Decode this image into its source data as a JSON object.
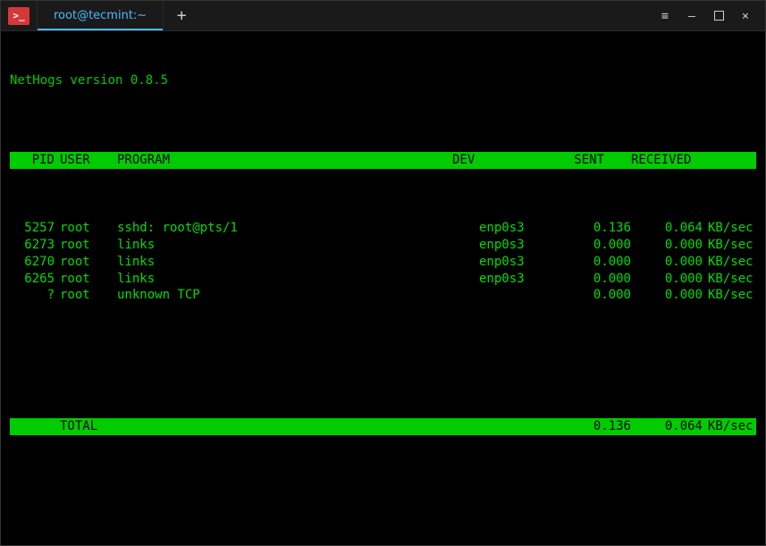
{
  "titlebar": {
    "app_icon_glyph": ">_",
    "tab_title": "root@tecmint:~",
    "new_tab_glyph": "+"
  },
  "window_controls": {
    "menu": "≡",
    "minimize": "–",
    "maximize": "▢",
    "close": "×"
  },
  "terminal": {
    "version_line": "NetHogs version 0.8.5",
    "headers": {
      "pid": "PID",
      "user": "USER",
      "program": "PROGRAM",
      "dev": "DEV",
      "sent": "SENT",
      "received": "RECEIVED"
    },
    "rows": [
      {
        "pid": "5257",
        "user": "root",
        "program": "sshd: root@pts/1",
        "dev": "enp0s3",
        "sent": "0.136",
        "recv": "0.064",
        "unit": "KB/sec"
      },
      {
        "pid": "6273",
        "user": "root",
        "program": "links",
        "dev": "enp0s3",
        "sent": "0.000",
        "recv": "0.000",
        "unit": "KB/sec"
      },
      {
        "pid": "6270",
        "user": "root",
        "program": "links",
        "dev": "enp0s3",
        "sent": "0.000",
        "recv": "0.000",
        "unit": "KB/sec"
      },
      {
        "pid": "6265",
        "user": "root",
        "program": "links",
        "dev": "enp0s3",
        "sent": "0.000",
        "recv": "0.000",
        "unit": "KB/sec"
      },
      {
        "pid": "?",
        "user": "root",
        "program": "unknown TCP",
        "dev": "",
        "sent": "0.000",
        "recv": "0.000",
        "unit": "KB/sec"
      }
    ],
    "total": {
      "label": "TOTAL",
      "sent": "0.136",
      "recv": "0.064",
      "unit": "KB/sec"
    }
  }
}
